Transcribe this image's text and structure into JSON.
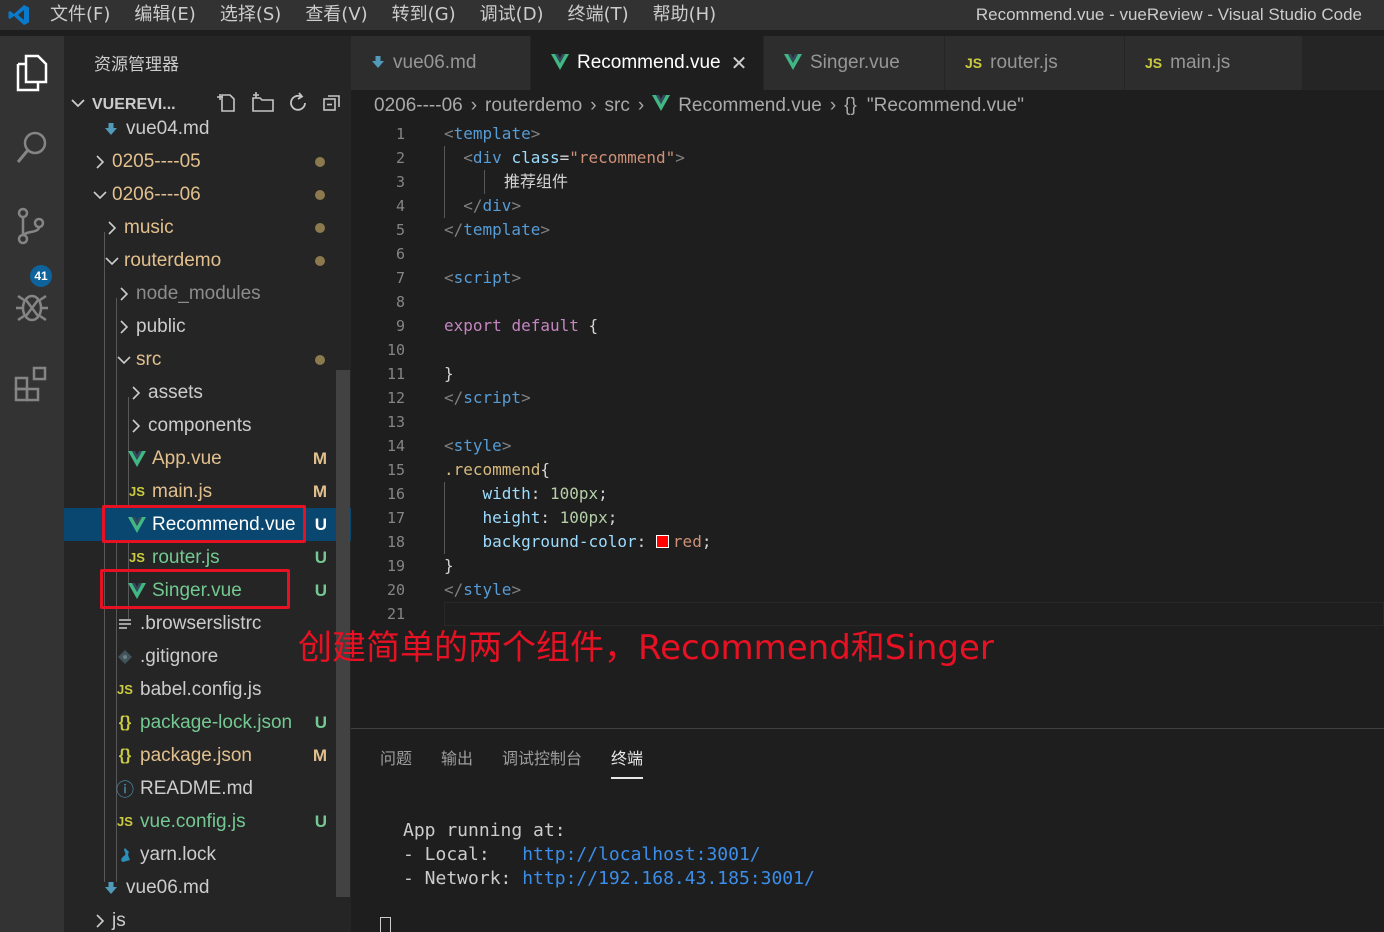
{
  "titlebar": {
    "menu": [
      "文件(F)",
      "编辑(E)",
      "选择(S)",
      "查看(V)",
      "转到(G)",
      "调试(D)",
      "终端(T)",
      "帮助(H)"
    ],
    "window_title": "Recommend.vue - vueReview - Visual Studio Code"
  },
  "activitybar": {
    "scm_badge": "41"
  },
  "sidebar": {
    "title": "资源管理器",
    "section": "VUEREVI...",
    "tree": [
      {
        "name": "vue04.md",
        "kind": "md",
        "status": ""
      },
      {
        "name": "0205----05",
        "kind": "folder",
        "status": "dot"
      },
      {
        "name": "0206----06",
        "kind": "folder-open",
        "status": "dot"
      },
      {
        "name": "music",
        "kind": "folder",
        "status": "dot"
      },
      {
        "name": "routerdemo",
        "kind": "folder-open",
        "status": "dot"
      },
      {
        "name": "node_modules",
        "kind": "folder",
        "status": ""
      },
      {
        "name": "public",
        "kind": "folder",
        "status": ""
      },
      {
        "name": "src",
        "kind": "folder-open",
        "status": "dot"
      },
      {
        "name": "assets",
        "kind": "folder",
        "status": ""
      },
      {
        "name": "components",
        "kind": "folder",
        "status": ""
      },
      {
        "name": "App.vue",
        "kind": "vue",
        "status": "M"
      },
      {
        "name": "main.js",
        "kind": "js",
        "status": "M"
      },
      {
        "name": "Recommend.vue",
        "kind": "vue",
        "status": "U"
      },
      {
        "name": "router.js",
        "kind": "js",
        "status": "U"
      },
      {
        "name": "Singer.vue",
        "kind": "vue",
        "status": "U"
      },
      {
        "name": ".browserslistrc",
        "kind": "lines",
        "status": ""
      },
      {
        "name": ".gitignore",
        "kind": "git",
        "status": ""
      },
      {
        "name": "babel.config.js",
        "kind": "js",
        "status": ""
      },
      {
        "name": "package-lock.json",
        "kind": "json",
        "status": "U"
      },
      {
        "name": "package.json",
        "kind": "json",
        "status": "M"
      },
      {
        "name": "README.md",
        "kind": "info",
        "status": ""
      },
      {
        "name": "vue.config.js",
        "kind": "js",
        "status": "U"
      },
      {
        "name": "yarn.lock",
        "kind": "yarn",
        "status": ""
      },
      {
        "name": "vue06.md",
        "kind": "md",
        "status": ""
      },
      {
        "name": "js",
        "kind": "folder",
        "status": ""
      }
    ]
  },
  "icons": {
    "js": "JS",
    "json": "{}",
    "info": "ⓘ"
  },
  "tabs": [
    {
      "label": "vue06.md",
      "kind": "md"
    },
    {
      "label": "Recommend.vue",
      "kind": "vue",
      "active": true
    },
    {
      "label": "Singer.vue",
      "kind": "vue"
    },
    {
      "label": "router.js",
      "kind": "js"
    },
    {
      "label": "main.js",
      "kind": "js"
    }
  ],
  "breadcrumb": [
    "0206----06",
    "routerdemo",
    "src",
    "Recommend.vue",
    "\"Recommend.vue\""
  ],
  "breadcrumb_symbol": "{}",
  "editor": {
    "line_numbers": [
      "1",
      "2",
      "3",
      "4",
      "5",
      "6",
      "7",
      "8",
      "9",
      "10",
      "11",
      "12",
      "13",
      "14",
      "15",
      "16",
      "17",
      "18",
      "19",
      "20",
      "21"
    ],
    "code": {
      "l1_tag": "template",
      "l2_tag": "div",
      "l2_attr": "class",
      "l2_val": "\"recommend\"",
      "l3_text": "推荐组件",
      "l4_tag": "div",
      "l5_tag": "template",
      "l7_tag": "script",
      "l9_kw1": "export",
      "l9_kw2": "default",
      "l9_brace": "{",
      "l11_brace": "}",
      "l12_tag": "script",
      "l14_tag": "style",
      "l15_sel": ".recommend",
      "l15_brace": "{",
      "l16_prop": "width",
      "l16_val": "100px",
      "l17_prop": "height",
      "l17_val": "100px",
      "l18_prop": "background-color",
      "l18_val": "red",
      "l19_brace": "}",
      "l20_tag": "style"
    },
    "swatch_color": "#ff0000"
  },
  "annotation": "创建简单的两个组件，Recommend和Singer",
  "panel": {
    "tabs": [
      "问题",
      "输出",
      "调试控制台",
      "终端"
    ],
    "active_tab": "终端",
    "terminal": {
      "line1": "App running at:",
      "local_label": "- Local:   ",
      "local_url": "http://localhost:3001/",
      "network_label": "- Network: ",
      "network_url": "http://192.168.43.185:3001/"
    }
  }
}
